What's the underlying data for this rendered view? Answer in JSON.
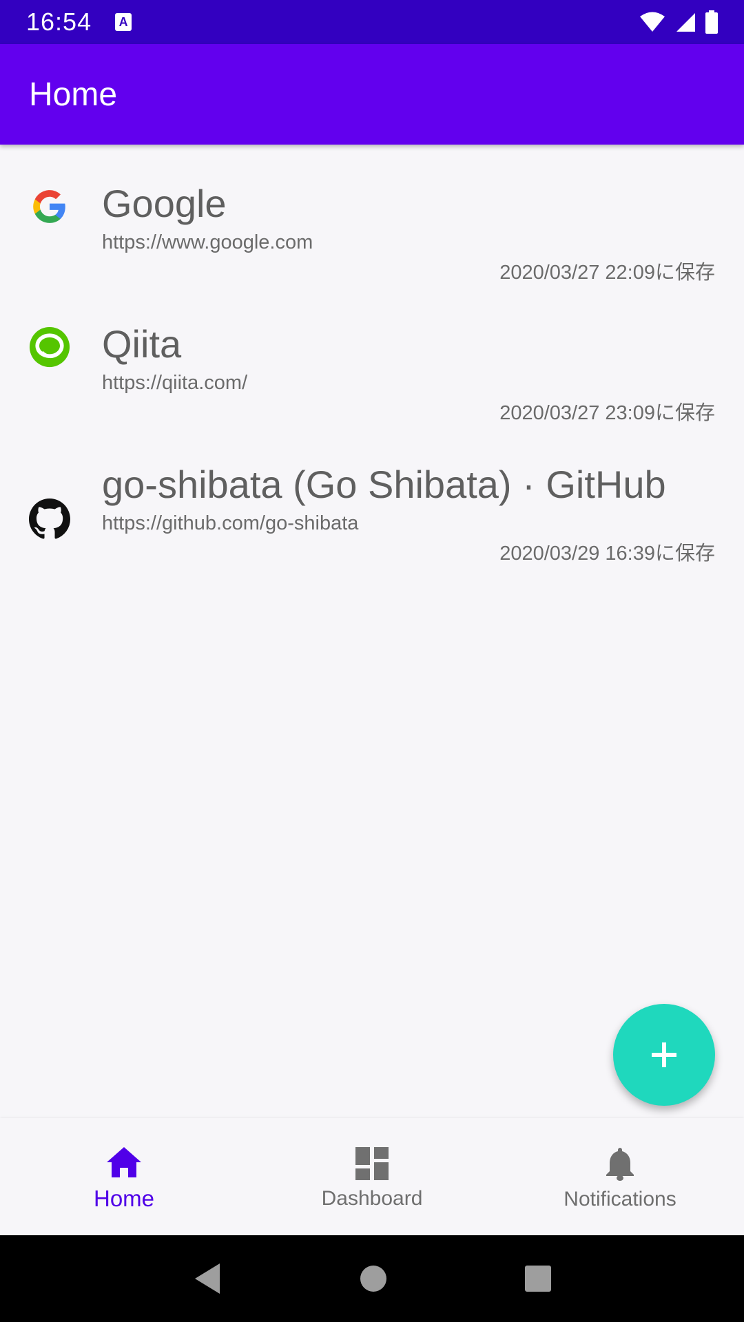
{
  "status_bar": {
    "time": "16:54",
    "notification_icon": "a-icon",
    "icons": [
      "wifi-icon",
      "signal-icon",
      "battery-icon"
    ]
  },
  "app_bar": {
    "title": "Home"
  },
  "bookmarks": [
    {
      "icon": "google-icon",
      "title": "Google",
      "url": "https://www.google.com",
      "saved": "2020/03/27 22:09に保存"
    },
    {
      "icon": "qiita-icon",
      "title": "Qiita",
      "url": "https://qiita.com/",
      "saved": "2020/03/27 23:09に保存"
    },
    {
      "icon": "github-icon",
      "title": "go-shibata (Go Shibata) · GitHub",
      "url": "https://github.com/go-shibata",
      "saved": "2020/03/29 16:39に保存"
    }
  ],
  "fab": {
    "icon": "plus-icon"
  },
  "bottom_nav": {
    "items": [
      {
        "label": "Home",
        "icon": "home-icon",
        "active": true
      },
      {
        "label": "Dashboard",
        "icon": "dashboard-icon",
        "active": false
      },
      {
        "label": "Notifications",
        "icon": "bell-icon",
        "active": false
      }
    ]
  },
  "system_nav": {
    "icons": [
      "back-icon",
      "home-circle-icon",
      "recents-icon"
    ]
  },
  "colors": {
    "status_bar": "#3300c0",
    "app_bar": "#6200ee",
    "fab": "#1fd8bd",
    "nav_active": "#5000e8"
  }
}
